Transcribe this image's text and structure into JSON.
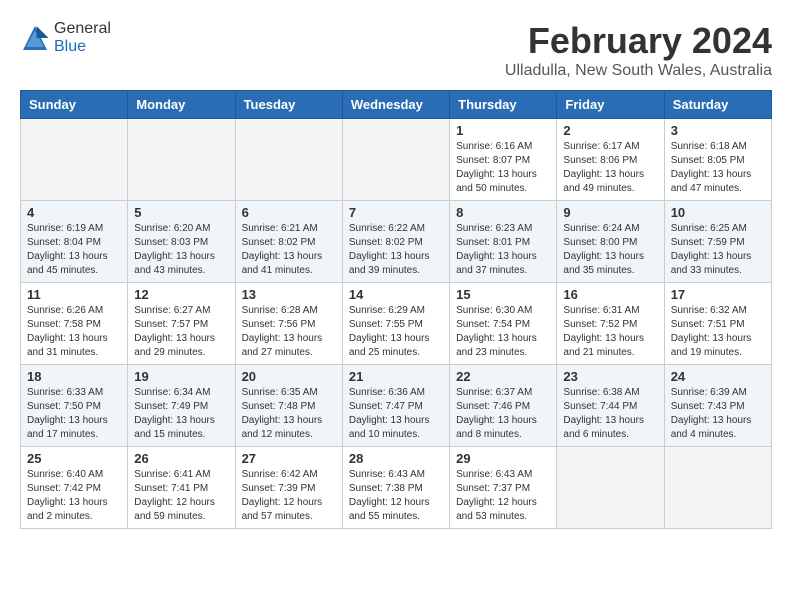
{
  "logo": {
    "general": "General",
    "blue": "Blue"
  },
  "title": "February 2024",
  "subtitle": "Ulladulla, New South Wales, Australia",
  "headers": [
    "Sunday",
    "Monday",
    "Tuesday",
    "Wednesday",
    "Thursday",
    "Friday",
    "Saturday"
  ],
  "weeks": [
    [
      {
        "day": "",
        "info": ""
      },
      {
        "day": "",
        "info": ""
      },
      {
        "day": "",
        "info": ""
      },
      {
        "day": "",
        "info": ""
      },
      {
        "day": "1",
        "info": "Sunrise: 6:16 AM\nSunset: 8:07 PM\nDaylight: 13 hours\nand 50 minutes."
      },
      {
        "day": "2",
        "info": "Sunrise: 6:17 AM\nSunset: 8:06 PM\nDaylight: 13 hours\nand 49 minutes."
      },
      {
        "day": "3",
        "info": "Sunrise: 6:18 AM\nSunset: 8:05 PM\nDaylight: 13 hours\nand 47 minutes."
      }
    ],
    [
      {
        "day": "4",
        "info": "Sunrise: 6:19 AM\nSunset: 8:04 PM\nDaylight: 13 hours\nand 45 minutes."
      },
      {
        "day": "5",
        "info": "Sunrise: 6:20 AM\nSunset: 8:03 PM\nDaylight: 13 hours\nand 43 minutes."
      },
      {
        "day": "6",
        "info": "Sunrise: 6:21 AM\nSunset: 8:02 PM\nDaylight: 13 hours\nand 41 minutes."
      },
      {
        "day": "7",
        "info": "Sunrise: 6:22 AM\nSunset: 8:02 PM\nDaylight: 13 hours\nand 39 minutes."
      },
      {
        "day": "8",
        "info": "Sunrise: 6:23 AM\nSunset: 8:01 PM\nDaylight: 13 hours\nand 37 minutes."
      },
      {
        "day": "9",
        "info": "Sunrise: 6:24 AM\nSunset: 8:00 PM\nDaylight: 13 hours\nand 35 minutes."
      },
      {
        "day": "10",
        "info": "Sunrise: 6:25 AM\nSunset: 7:59 PM\nDaylight: 13 hours\nand 33 minutes."
      }
    ],
    [
      {
        "day": "11",
        "info": "Sunrise: 6:26 AM\nSunset: 7:58 PM\nDaylight: 13 hours\nand 31 minutes."
      },
      {
        "day": "12",
        "info": "Sunrise: 6:27 AM\nSunset: 7:57 PM\nDaylight: 13 hours\nand 29 minutes."
      },
      {
        "day": "13",
        "info": "Sunrise: 6:28 AM\nSunset: 7:56 PM\nDaylight: 13 hours\nand 27 minutes."
      },
      {
        "day": "14",
        "info": "Sunrise: 6:29 AM\nSunset: 7:55 PM\nDaylight: 13 hours\nand 25 minutes."
      },
      {
        "day": "15",
        "info": "Sunrise: 6:30 AM\nSunset: 7:54 PM\nDaylight: 13 hours\nand 23 minutes."
      },
      {
        "day": "16",
        "info": "Sunrise: 6:31 AM\nSunset: 7:52 PM\nDaylight: 13 hours\nand 21 minutes."
      },
      {
        "day": "17",
        "info": "Sunrise: 6:32 AM\nSunset: 7:51 PM\nDaylight: 13 hours\nand 19 minutes."
      }
    ],
    [
      {
        "day": "18",
        "info": "Sunrise: 6:33 AM\nSunset: 7:50 PM\nDaylight: 13 hours\nand 17 minutes."
      },
      {
        "day": "19",
        "info": "Sunrise: 6:34 AM\nSunset: 7:49 PM\nDaylight: 13 hours\nand 15 minutes."
      },
      {
        "day": "20",
        "info": "Sunrise: 6:35 AM\nSunset: 7:48 PM\nDaylight: 13 hours\nand 12 minutes."
      },
      {
        "day": "21",
        "info": "Sunrise: 6:36 AM\nSunset: 7:47 PM\nDaylight: 13 hours\nand 10 minutes."
      },
      {
        "day": "22",
        "info": "Sunrise: 6:37 AM\nSunset: 7:46 PM\nDaylight: 13 hours\nand 8 minutes."
      },
      {
        "day": "23",
        "info": "Sunrise: 6:38 AM\nSunset: 7:44 PM\nDaylight: 13 hours\nand 6 minutes."
      },
      {
        "day": "24",
        "info": "Sunrise: 6:39 AM\nSunset: 7:43 PM\nDaylight: 13 hours\nand 4 minutes."
      }
    ],
    [
      {
        "day": "25",
        "info": "Sunrise: 6:40 AM\nSunset: 7:42 PM\nDaylight: 13 hours\nand 2 minutes."
      },
      {
        "day": "26",
        "info": "Sunrise: 6:41 AM\nSunset: 7:41 PM\nDaylight: 12 hours\nand 59 minutes."
      },
      {
        "day": "27",
        "info": "Sunrise: 6:42 AM\nSunset: 7:39 PM\nDaylight: 12 hours\nand 57 minutes."
      },
      {
        "day": "28",
        "info": "Sunrise: 6:43 AM\nSunset: 7:38 PM\nDaylight: 12 hours\nand 55 minutes."
      },
      {
        "day": "29",
        "info": "Sunrise: 6:43 AM\nSunset: 7:37 PM\nDaylight: 12 hours\nand 53 minutes."
      },
      {
        "day": "",
        "info": ""
      },
      {
        "day": "",
        "info": ""
      }
    ]
  ]
}
